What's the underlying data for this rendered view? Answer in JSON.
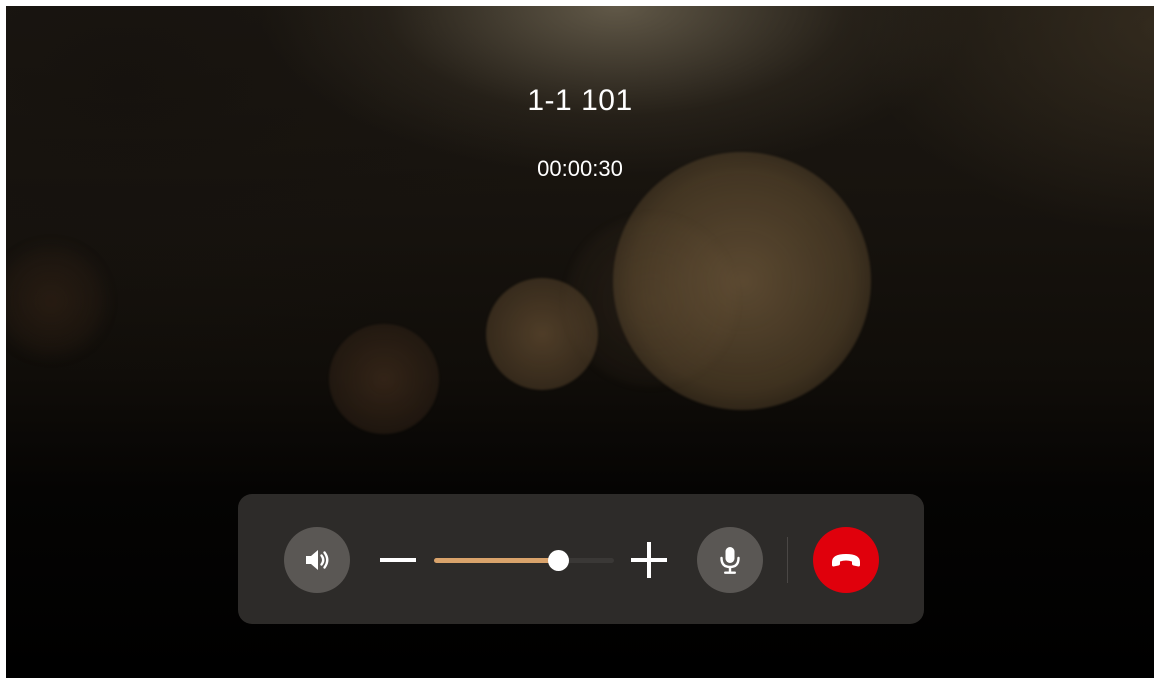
{
  "call": {
    "caller_name": "1-1 101",
    "duration": "00:00:30"
  },
  "controls": {
    "speaker_icon": "speaker-volume-icon",
    "volume_down_icon": "minus-icon",
    "volume_up_icon": "plus-icon",
    "mic_icon": "microphone-icon",
    "hangup_icon": "phone-hangup-icon",
    "volume_level": 0.69
  },
  "colors": {
    "volume_fill": "#d9a36b",
    "hangup": "#e0000c",
    "control_bar": "#2d2b29",
    "icon_button": "#5a5754"
  }
}
